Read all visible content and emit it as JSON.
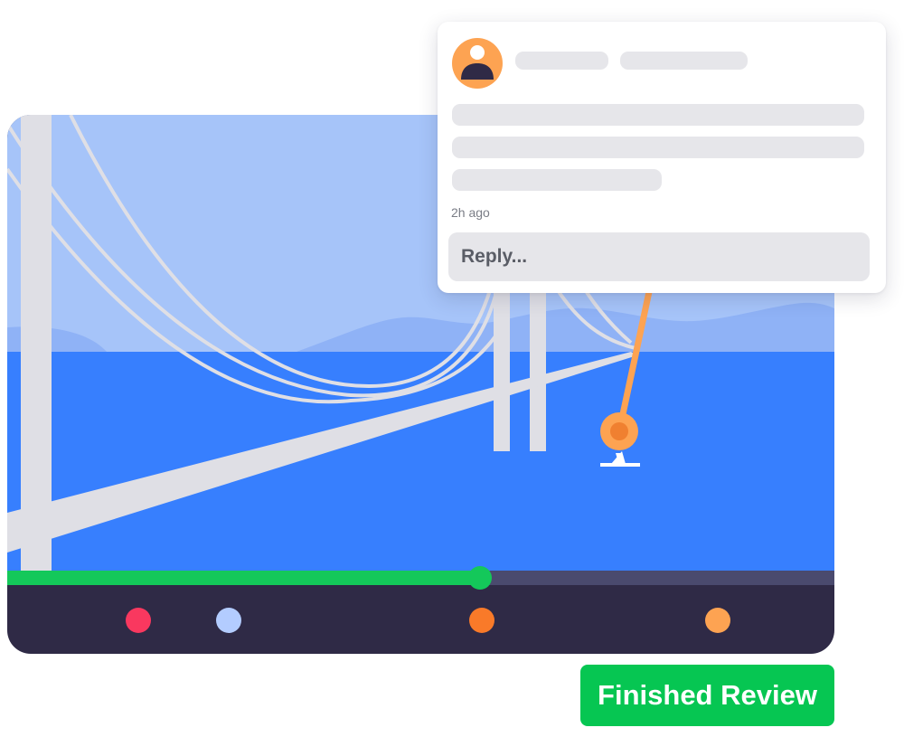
{
  "comment": {
    "timestamp": "2h ago",
    "reply_placeholder": "Reply..."
  },
  "actions": {
    "finished_review_label": "Finished Review"
  },
  "playback": {
    "progress": 0.572
  },
  "timeline_markers": [
    {
      "name": "marker-red",
      "color": "#f9385f",
      "position": 0.159
    },
    {
      "name": "marker-light-blue",
      "color": "#b3ccff",
      "position": 0.268
    },
    {
      "name": "marker-orange",
      "color": "#f97a29",
      "position": 0.574
    },
    {
      "name": "marker-light-orange",
      "color": "#fda352",
      "position": 0.859
    }
  ],
  "colors": {
    "sky": "#a6c4f9",
    "water": "#377ffe",
    "bridge": "#dfdfe5",
    "player_bar": "#2f2a46",
    "progress": "#14c85a",
    "annotation": "#fda352",
    "button": "#06c652"
  },
  "icons": {
    "avatar": "user-avatar-icon",
    "annotation_pin": "annotation-pin-icon",
    "sailboat": "sailboat-icon"
  }
}
